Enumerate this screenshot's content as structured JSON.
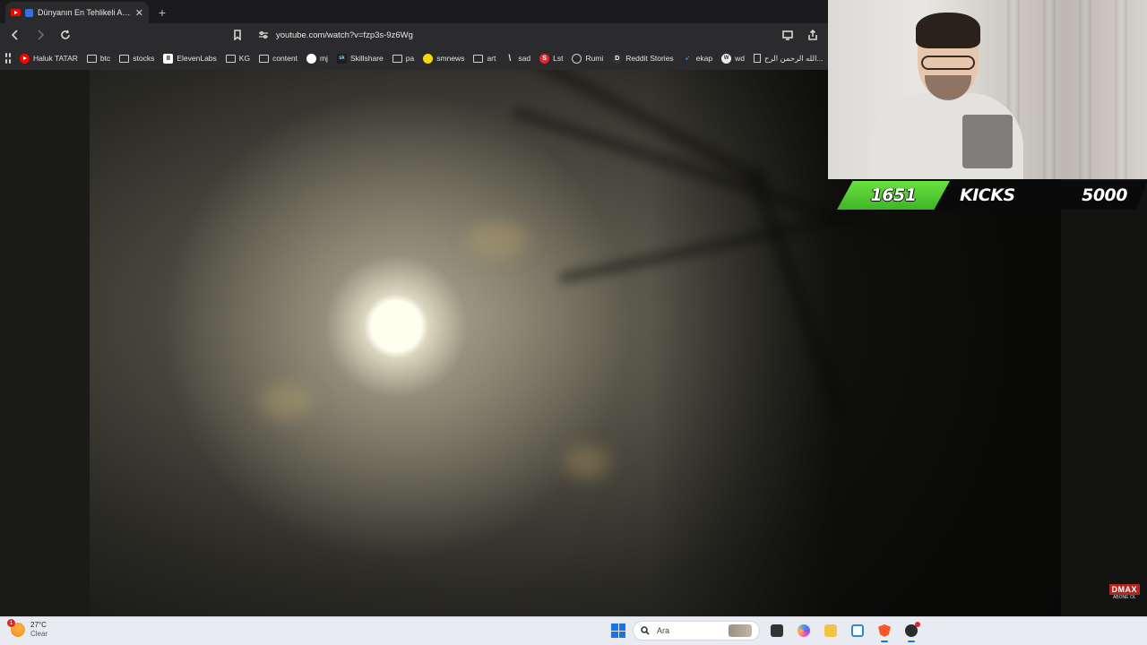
{
  "browser": {
    "tab": {
      "title": "Dünyanın En Tehlikeli Anların",
      "close": "✕"
    },
    "new_tab": "+",
    "url": "youtube.com/watch?v=fzp3s-9z6Wg",
    "bookmarks": [
      {
        "label": "Haluk TATAR",
        "icon": "youtube-icon"
      },
      {
        "label": "btc",
        "icon": "folder-icon"
      },
      {
        "label": "stocks",
        "icon": "folder-icon"
      },
      {
        "label": "ElevenLabs",
        "icon": "elevenlabs-icon"
      },
      {
        "label": "KG",
        "icon": "folder-icon"
      },
      {
        "label": "content",
        "icon": "folder-icon"
      },
      {
        "label": "mj",
        "icon": "github-icon"
      },
      {
        "label": "Skillshare",
        "icon": "skillshare-icon"
      },
      {
        "label": "pa",
        "icon": "folder-icon"
      },
      {
        "label": "smnews",
        "icon": "smiley-icon"
      },
      {
        "label": "art",
        "icon": "folder-icon"
      },
      {
        "label": "sad",
        "icon": "slash-icon"
      },
      {
        "label": "Lst",
        "icon": "s-logo-icon"
      },
      {
        "label": "Rumi",
        "icon": "globe-icon"
      },
      {
        "label": "Reddit Stories",
        "icon": "d-logo-icon"
      },
      {
        "label": "ekap",
        "icon": "bird-icon"
      },
      {
        "label": "wd",
        "icon": "wordpress-icon"
      },
      {
        "label": "الله الرحمن الرح...",
        "icon": "document-icon"
      }
    ]
  },
  "stream_overlay": {
    "kicks_current": "1651",
    "kicks_label": "KICKS",
    "kicks_goal": "5000",
    "channel_logo": "DMAX",
    "channel_logo_sub": "ABONE OL",
    "colors": {
      "kicks_green": "#53c934",
      "kicks_black": "#0a0a0a"
    }
  },
  "taskbar": {
    "weather": {
      "temp": "27°C",
      "condition": "Clear",
      "badge": "1"
    },
    "search_placeholder": "Ara",
    "apps": [
      "start-icon",
      "task-view-icon",
      "copilot-icon",
      "file-explorer-icon",
      "snipping-tool-icon",
      "brave-browser-icon",
      "obs-icon"
    ]
  }
}
